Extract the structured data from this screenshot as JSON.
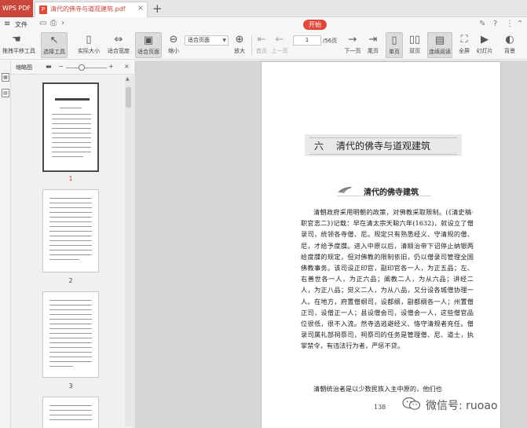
{
  "titlebar": {
    "app_name": "WPS PDF",
    "doc_tab": "清代的佛寺与道观建筑.pdf",
    "pdf_badge": "P",
    "close": "×",
    "new_tab": "+"
  },
  "menubar": {
    "file_label": "文件",
    "start_tab": "开始"
  },
  "toolbar": {
    "buttons": [
      {
        "label": "拖拽平移工具",
        "icon": "hand-icon"
      },
      {
        "label": "选择工具",
        "icon": "pointer-icon"
      },
      {
        "label": "实际大小",
        "icon": "actual-size-icon"
      },
      {
        "label": "适合宽度",
        "icon": "fit-width-icon"
      },
      {
        "label": "适合页面",
        "icon": "fit-page-icon"
      },
      {
        "label": "缩小",
        "icon": "zoom-out-icon"
      },
      {
        "label": "放大",
        "icon": "zoom-in-icon"
      },
      {
        "label": "首页",
        "icon": "first-page-icon"
      },
      {
        "label": "上一页",
        "icon": "prev-page-icon"
      },
      {
        "label": "下一页",
        "icon": "next-page-icon"
      },
      {
        "label": "尾页",
        "icon": "last-page-icon"
      },
      {
        "label": "单页",
        "icon": "single-page-icon"
      },
      {
        "label": "双页",
        "icon": "double-page-icon"
      },
      {
        "label": "连续阅读",
        "icon": "continuous-icon"
      },
      {
        "label": "全屏",
        "icon": "fullscreen-icon"
      },
      {
        "label": "幻灯片",
        "icon": "slideshow-icon"
      },
      {
        "label": "背景",
        "icon": "background-icon"
      }
    ],
    "zoom_value": "适合页面",
    "page_value": "1",
    "page_total": "/56页"
  },
  "thumbnails": {
    "title": "缩略图",
    "pages": [
      {
        "num": "1",
        "selected": true
      },
      {
        "num": "2",
        "selected": false
      },
      {
        "num": "3",
        "selected": false
      }
    ]
  },
  "page": {
    "chapter_num": "六",
    "chapter_title": "清代的佛寺与道观建筑",
    "section_title": "清代的佛寺建筑",
    "body": "清朝政府采用明朝的政策，对佛教采取限制。(《清史稿·职官志二》)记载：早在清太宗天聪六年(1632)，就设立了僧录司，统领各寺僧、尼。规定只有熟悉经义、守清规的僧、尼，才给予度牒。进入中原以后，清顺治帝下诏停止纳银两给度牒的规定，但对佛教的限制依旧，仍以僧录司管理全国佛教事务。该司设正印官，副印官各一人，为正五品；左、右善世各一人，为正六品；阐教二人，为从六品；讲经二人，为正八品；觉义二人，为从八品，又分设各城僧协理一人。在地方，府置僧纲司，设都纲，副都纲各一人；州置僧正司，设僧正一人；县设僧会司，设僧会一人，这些僧官品位很低，很不入流。然寺选逃避经义、恪守清规者充任。僧录司属礼部祠祭司，祠祭司的任务是管理僧、尼、道士，执掌禁令，有违法行为者，严惩不贷。",
    "body_2": "清朝统治者是以少数民族入主中原的，他们也",
    "page_no": "138"
  },
  "watermark": {
    "text": "微信号: ruoao"
  },
  "colors": {
    "accent": "#c9473b",
    "start_tab": "#e0493a"
  }
}
